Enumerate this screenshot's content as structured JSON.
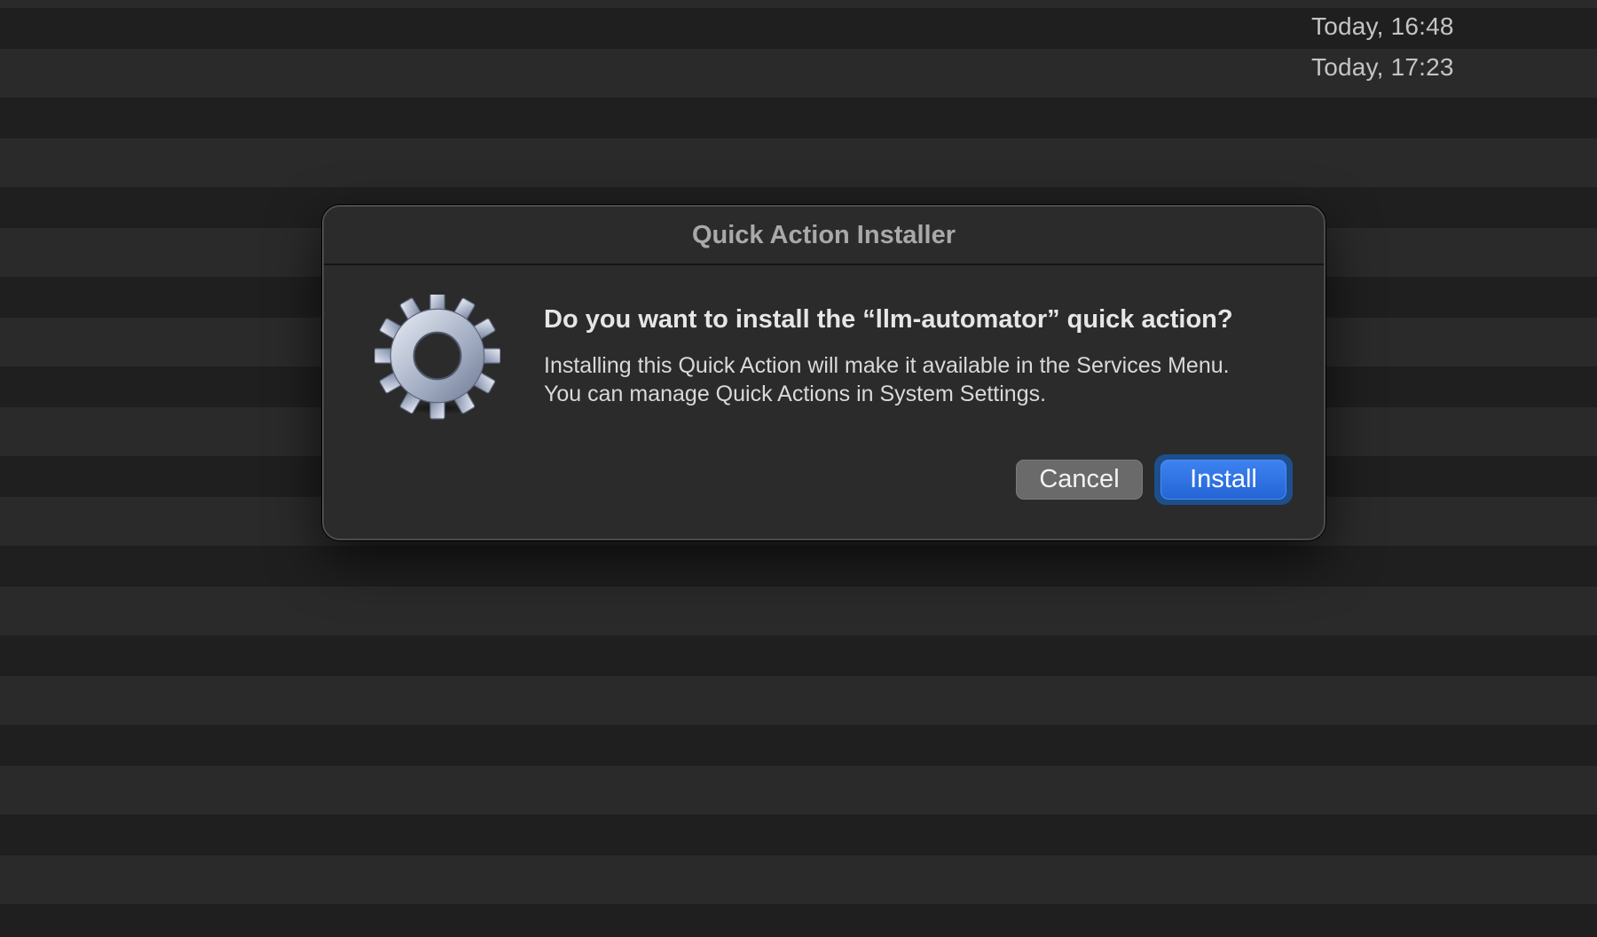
{
  "background_list": {
    "rows": [
      {
        "date": "Today, 16:48"
      },
      {
        "date": "Today, 17:23"
      }
    ]
  },
  "dialog": {
    "window_title": "Quick Action Installer",
    "icon": "gear-icon",
    "headline": "Do you want to install the “llm-automator” quick action?",
    "informative_text": "Installing this Quick Action will make it available in the Services Menu. You can manage Quick Actions in System Settings.",
    "buttons": {
      "cancel_label": "Cancel",
      "install_label": "Install"
    },
    "colors": {
      "default_button": "#2f73e4",
      "cancel_button": "#6a6a6a",
      "dialog_background": "#2b2b2b"
    }
  }
}
